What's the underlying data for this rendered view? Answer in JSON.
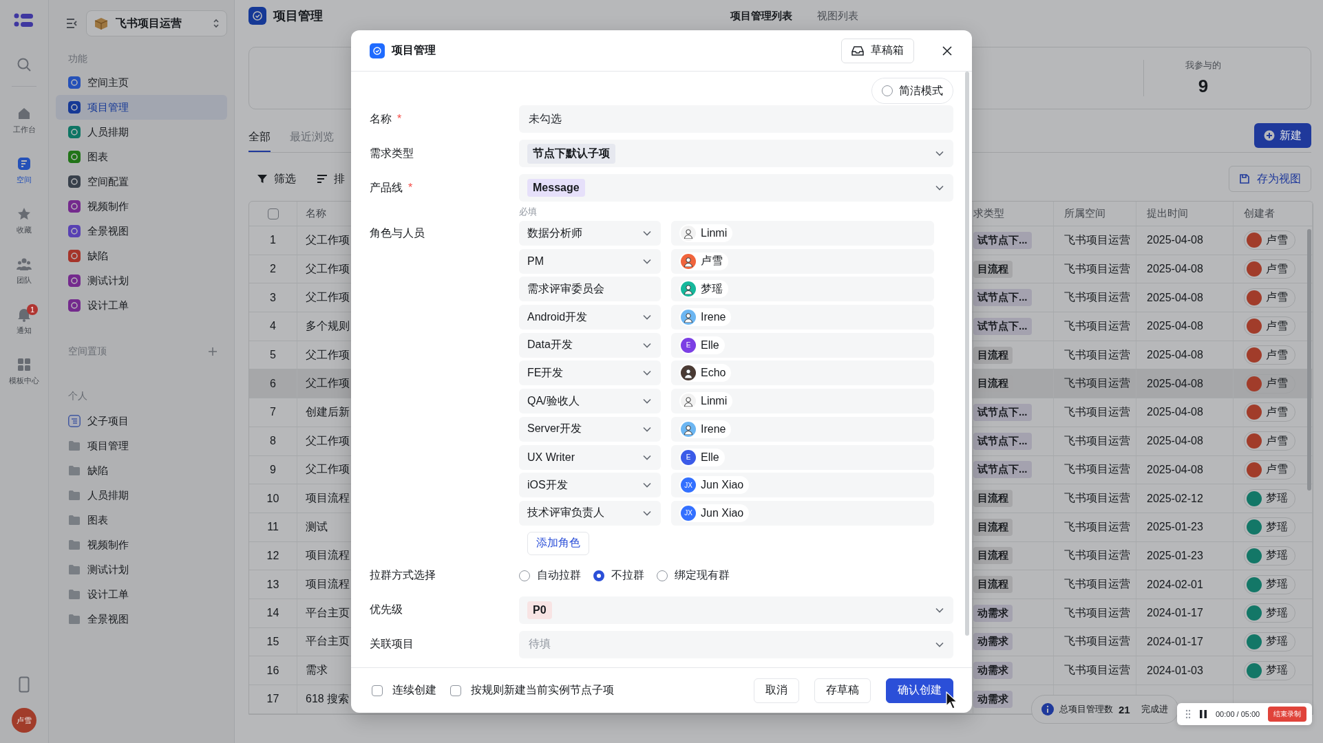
{
  "rail": {
    "items": [
      {
        "label": "工作台",
        "selected": false
      },
      {
        "label": "空间",
        "selected": true
      },
      {
        "label": "收藏",
        "selected": false
      },
      {
        "label": "团队",
        "selected": false
      },
      {
        "label": "通知",
        "selected": false,
        "badge": "1"
      },
      {
        "label": "模板中心",
        "selected": false
      }
    ],
    "avatar": "卢雪"
  },
  "sidebar": {
    "workspace": "飞书项目运营",
    "sections": [
      {
        "title": "功能",
        "items": [
          {
            "label": "空间主页",
            "color": "#2551b8",
            "selected": false,
            "kind": "app"
          },
          {
            "label": "项目管理",
            "color": "#163996",
            "selected": true,
            "kind": "app"
          },
          {
            "label": "人员排期",
            "color": "#0e7564",
            "selected": false,
            "kind": "app"
          },
          {
            "label": "图表",
            "color": "#217418",
            "selected": false,
            "kind": "app"
          },
          {
            "label": "空间配置",
            "color": "#38404b",
            "selected": false,
            "kind": "app"
          },
          {
            "label": "视频制作",
            "color": "#742a8d",
            "selected": false,
            "kind": "app"
          },
          {
            "label": "全景视图",
            "color": "#5841b3",
            "selected": false,
            "kind": "app"
          },
          {
            "label": "缺陷",
            "color": "#a5342a",
            "selected": false,
            "kind": "app"
          },
          {
            "label": "测试计划",
            "color": "#742a8d",
            "selected": false,
            "kind": "app"
          },
          {
            "label": "设计工单",
            "color": "#742a8d",
            "selected": false,
            "kind": "app"
          }
        ]
      },
      {
        "title": "空间置顶",
        "addable": true
      },
      {
        "title": "个人",
        "items": [
          {
            "label": "父子项目",
            "selected": false,
            "kind": "list"
          },
          {
            "label": "项目管理",
            "selected": false,
            "kind": "folder"
          },
          {
            "label": "缺陷",
            "selected": false,
            "kind": "folder"
          },
          {
            "label": "人员排期",
            "selected": false,
            "kind": "folder"
          },
          {
            "label": "图表",
            "selected": false,
            "kind": "folder"
          },
          {
            "label": "视频制作",
            "selected": false,
            "kind": "folder"
          },
          {
            "label": "测试计划",
            "selected": false,
            "kind": "folder"
          },
          {
            "label": "设计工单",
            "selected": false,
            "kind": "folder"
          },
          {
            "label": "全景视图",
            "selected": false,
            "kind": "folder"
          }
        ]
      }
    ]
  },
  "header": {
    "title": "项目管理",
    "tabs": [
      {
        "label": "项目管理列表",
        "selected": true
      },
      {
        "label": "视图列表",
        "selected": false
      }
    ]
  },
  "stat": {
    "label": "我参与的",
    "value": "9"
  },
  "view_tabs": [
    {
      "label": "全部",
      "selected": true
    },
    {
      "label": "最近浏览",
      "selected": false
    }
  ],
  "new_button": "新建",
  "toolbar": {
    "filter": "筛选",
    "sort": "排",
    "save_view": "存为视图"
  },
  "table": {
    "select_all": false,
    "columns": [
      "名称",
      "求类型",
      "所属空间",
      "提出时间",
      "创建者"
    ],
    "rows": [
      {
        "no": "1",
        "name": "父工作项",
        "type": {
          "label": "试节点下...",
          "color": "#a4a2af"
        },
        "space": "飞书项目运营",
        "date": "2025-04-08",
        "creator": {
          "name": "卢雪",
          "color": "#a13c2a"
        },
        "selected": false
      },
      {
        "no": "2",
        "name": "父工作项",
        "type": {
          "label": "目流程",
          "color": "#a6a6a8"
        },
        "space": "飞书项目运营",
        "date": "2025-04-08",
        "creator": {
          "name": "卢雪",
          "color": "#a13c2a"
        },
        "selected": false
      },
      {
        "no": "3",
        "name": "父工作项",
        "type": {
          "label": "试节点下...",
          "color": "#a4a2af"
        },
        "space": "飞书项目运营",
        "date": "2025-04-08",
        "creator": {
          "name": "卢雪",
          "color": "#a13c2a"
        },
        "selected": false
      },
      {
        "no": "4",
        "name": "多个规则",
        "type": {
          "label": "试节点下...",
          "color": "#a4a2af"
        },
        "space": "飞书项目运营",
        "date": "2025-04-08",
        "creator": {
          "name": "卢雪",
          "color": "#a13c2a"
        },
        "selected": false
      },
      {
        "no": "5",
        "name": "父工作项",
        "type": {
          "label": "目流程",
          "color": "#a6a6a8"
        },
        "space": "飞书项目运营",
        "date": "2025-04-08",
        "creator": {
          "name": "卢雪",
          "color": "#a13c2a"
        },
        "selected": false
      },
      {
        "no": "6",
        "name": "父工作项",
        "type": {
          "label": "目流程",
          "color": "#a6a6a8"
        },
        "space": "飞书项目运营",
        "date": "2025-04-08",
        "creator": {
          "name": "卢雪",
          "color": "#a13c2a"
        },
        "selected": true
      },
      {
        "no": "7",
        "name": "创建后新",
        "type": {
          "label": "试节点下...",
          "color": "#a4a2af"
        },
        "space": "飞书项目运营",
        "date": "2025-04-08",
        "creator": {
          "name": "卢雪",
          "color": "#a13c2a"
        },
        "selected": false
      },
      {
        "no": "8",
        "name": "父工作项",
        "type": {
          "label": "试节点下...",
          "color": "#a4a2af"
        },
        "space": "飞书项目运营",
        "date": "2025-04-08",
        "creator": {
          "name": "卢雪",
          "color": "#a13c2a"
        },
        "selected": false
      },
      {
        "no": "9",
        "name": "父工作项",
        "type": {
          "label": "试节点下...",
          "color": "#a4a2af"
        },
        "space": "飞书项目运营",
        "date": "2025-04-08",
        "creator": {
          "name": "卢雪",
          "color": "#a13c2a"
        },
        "selected": false
      },
      {
        "no": "10",
        "name": "项目流程",
        "type": {
          "label": "目流程",
          "color": "#a6a6a8"
        },
        "space": "飞书项目运营",
        "date": "2025-02-12",
        "creator": {
          "name": "梦瑶",
          "color": "#137767"
        },
        "selected": false
      },
      {
        "no": "11",
        "name": "测试",
        "type": {
          "label": "目流程",
          "color": "#a6a6a8"
        },
        "space": "飞书项目运营",
        "date": "2025-01-23",
        "creator": {
          "name": "梦瑶",
          "color": "#137767"
        },
        "selected": false
      },
      {
        "no": "12",
        "name": "项目流程",
        "type": {
          "label": "目流程",
          "color": "#a6a6a8"
        },
        "space": "飞书项目运营",
        "date": "2025-01-23",
        "creator": {
          "name": "梦瑶",
          "color": "#137767"
        },
        "selected": false
      },
      {
        "no": "13",
        "name": "项目流程",
        "type": {
          "label": "目流程",
          "color": "#a6a6a8"
        },
        "space": "飞书项目运营",
        "date": "2024-02-01",
        "creator": {
          "name": "梦瑶",
          "color": "#137767"
        },
        "selected": false
      },
      {
        "no": "14",
        "name": "平台主页",
        "type": {
          "label": "动需求",
          "color": "#a4a2af"
        },
        "space": "飞书项目运营",
        "date": "2024-01-17",
        "creator": {
          "name": "梦瑶",
          "color": "#137767"
        },
        "selected": false
      },
      {
        "no": "15",
        "name": "平台主页",
        "type": {
          "label": "动需求",
          "color": "#a4a2af"
        },
        "space": "飞书项目运营",
        "date": "2024-01-17",
        "creator": {
          "name": "梦瑶",
          "color": "#137767"
        },
        "selected": false
      },
      {
        "no": "16",
        "name": "需求",
        "type": {
          "label": "动需求",
          "color": "#a4a2af"
        },
        "space": "飞书项目运营",
        "date": "2024-01-03",
        "creator": {
          "name": "梦瑶",
          "color": "#137767"
        },
        "selected": false
      },
      {
        "no": "17",
        "name": "618 搜索",
        "type": {
          "label": "动需求",
          "color": "#a4a2af"
        },
        "selected": false
      }
    ]
  },
  "summary": {
    "label": "总项目管理数",
    "value": "21",
    "next": "完成进"
  },
  "recorder": {
    "time": "00:00 / 05:00",
    "stop": "结束录制"
  },
  "modal": {
    "title": "项目管理",
    "drafts": "草稿箱",
    "simple_mode": {
      "label": "简洁模式",
      "on": false
    },
    "fields": [
      {
        "kind": "input",
        "label": "名称",
        "required_mark": "*",
        "value": "未勾选"
      },
      {
        "kind": "select",
        "label": "需求类型",
        "tag": {
          "label": "节点下默认子项",
          "color": "#e6e8ef"
        }
      },
      {
        "kind": "select",
        "label": "产品线",
        "required_mark": "*",
        "tag": {
          "label": "Message",
          "color": "#e6e0fa"
        },
        "hint": "必填"
      },
      {
        "kind": "roles",
        "label": "角色与人员",
        "add": "添加角色",
        "roles": [
          {
            "role": "数据分析师",
            "dropdown": true,
            "person": "Linmi",
            "color": "#f2f2f2"
          },
          {
            "role": "PM",
            "dropdown": true,
            "person": "卢雪",
            "color": "#f0643c"
          },
          {
            "role": "需求评审委员会",
            "dropdown": false,
            "person": "梦瑶",
            "color": "#16b89c"
          },
          {
            "role": "Android开发",
            "dropdown": true,
            "person": "Irene",
            "color": "#6cb6f2"
          },
          {
            "role": "Data开发",
            "dropdown": true,
            "person": "Elle",
            "color": "#7b3fe4",
            "initials": "E"
          },
          {
            "role": "FE开发",
            "dropdown": true,
            "person": "Echo",
            "color": "#4a3a33"
          },
          {
            "role": "QA/验收人",
            "dropdown": true,
            "person": "Linmi",
            "color": "#f2f2f2"
          },
          {
            "role": "Server开发",
            "dropdown": true,
            "person": "Irene",
            "color": "#6cb6f2"
          },
          {
            "role": "UX Writer",
            "dropdown": true,
            "person": "Elle",
            "color": "#3b5be8",
            "initials": "E"
          },
          {
            "role": "iOS开发",
            "dropdown": true,
            "person": "Jun Xiao",
            "color": "#3370ff",
            "initials": "JX"
          },
          {
            "role": "技术评审负责人",
            "dropdown": true,
            "person": "Jun Xiao",
            "color": "#3370ff",
            "initials": "JX"
          }
        ]
      },
      {
        "kind": "radio",
        "label": "拉群方式选择",
        "options": [
          {
            "label": "自动拉群",
            "selected": false
          },
          {
            "label": "不拉群",
            "selected": true
          },
          {
            "label": "绑定现有群",
            "selected": false
          }
        ]
      },
      {
        "kind": "select",
        "label": "优先级",
        "tag": {
          "label": "P0",
          "color": "#f8e4e4"
        }
      },
      {
        "kind": "select",
        "label": "关联项目",
        "placeholder": "待填"
      }
    ],
    "footer": {
      "checks": [
        {
          "label": "连续创建",
          "checked": false
        },
        {
          "label": "按规则新建当前实例节点子项",
          "checked": false
        }
      ],
      "buttons": [
        {
          "label": "取消",
          "kind": "default"
        },
        {
          "label": "存草稿",
          "kind": "default"
        },
        {
          "label": "确认创建",
          "kind": "primary"
        }
      ]
    }
  }
}
